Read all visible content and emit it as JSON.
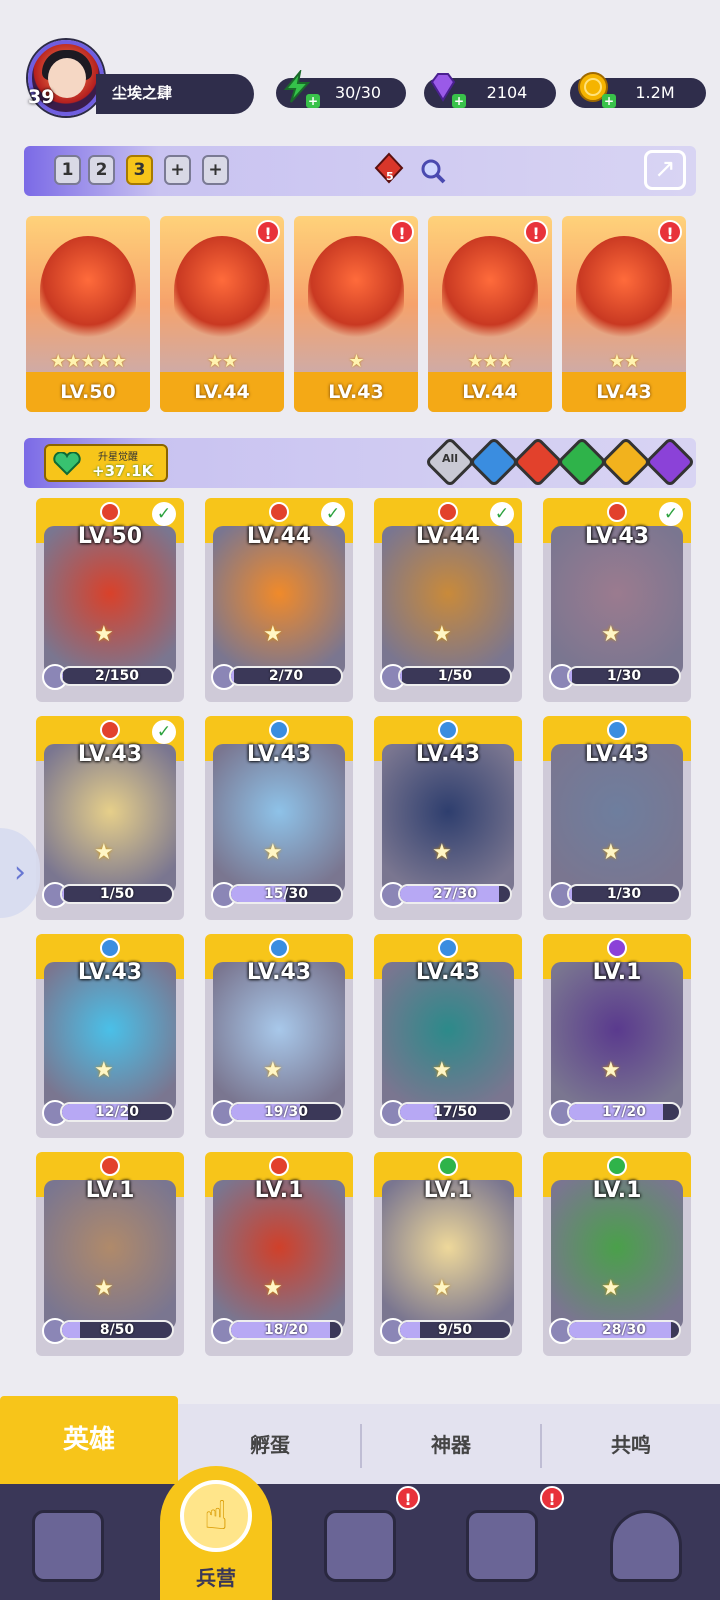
{
  "player": {
    "level": "39",
    "name": "尘埃之肆"
  },
  "resources": [
    {
      "icon": "lightning-energy-icon",
      "value": "30/30",
      "color": "#35c24a"
    },
    {
      "icon": "gem-icon",
      "value": "2104",
      "color": "#8a4ae0"
    },
    {
      "icon": "gold-coin-icon",
      "value": "1.2M",
      "color": "#f5b400"
    }
  ],
  "team_bar": {
    "slots": [
      "1",
      "2",
      "3",
      "+",
      "+"
    ],
    "selected_slot": "3",
    "fire_badge_count": "5"
  },
  "team": [
    {
      "level": "LV.50",
      "stars": "★★★★★",
      "alert": false
    },
    {
      "level": "LV.44",
      "stars": "★★",
      "alert": true
    },
    {
      "level": "LV.43",
      "stars": "★",
      "alert": true
    },
    {
      "level": "LV.44",
      "stars": "★★★",
      "alert": true
    },
    {
      "level": "LV.43",
      "stars": "★★",
      "alert": true
    }
  ],
  "awaken": {
    "label": "升星觉醒",
    "value": "+37.1K"
  },
  "filters": [
    {
      "name": "All",
      "color": "#c9c9d4"
    },
    {
      "name": "water",
      "color": "#3a8de0"
    },
    {
      "name": "fire",
      "color": "#e2412c"
    },
    {
      "name": "nature",
      "color": "#2fb34a"
    },
    {
      "name": "light",
      "color": "#f2b21d"
    },
    {
      "name": "dark",
      "color": "#8b42d8"
    }
  ],
  "heroes": [
    {
      "level": "LV.50",
      "element": "fire",
      "progress": "2/150",
      "ratio": 0.013,
      "checked": true,
      "art": "#d9412a"
    },
    {
      "level": "LV.44",
      "element": "fire",
      "progress": "2/70",
      "ratio": 0.03,
      "checked": true,
      "art": "#f08a2a"
    },
    {
      "level": "LV.44",
      "element": "fire",
      "progress": "1/50",
      "ratio": 0.02,
      "checked": true,
      "art": "#c98a3a"
    },
    {
      "level": "LV.43",
      "element": "fire",
      "progress": "1/30",
      "ratio": 0.03,
      "checked": true,
      "art": "#9b7b8f"
    },
    {
      "level": "LV.43",
      "element": "fire",
      "progress": "1/50",
      "ratio": 0.02,
      "checked": true,
      "art": "#e6cf8a"
    },
    {
      "level": "LV.43",
      "element": "water",
      "progress": "15/30",
      "ratio": 0.5,
      "checked": false,
      "art": "#8ec2e8"
    },
    {
      "level": "LV.43",
      "element": "water",
      "progress": "27/30",
      "ratio": 0.9,
      "checked": false,
      "art": "#2e3e6e"
    },
    {
      "level": "LV.43",
      "element": "water",
      "progress": "1/30",
      "ratio": 0.03,
      "checked": false,
      "art": "#6e7e9e"
    },
    {
      "level": "LV.43",
      "element": "water",
      "progress": "12/20",
      "ratio": 0.6,
      "checked": false,
      "art": "#4ac0e8"
    },
    {
      "level": "LV.43",
      "element": "water",
      "progress": "19/30",
      "ratio": 0.63,
      "checked": false,
      "art": "#a8c8ea"
    },
    {
      "level": "LV.43",
      "element": "water",
      "progress": "17/50",
      "ratio": 0.34,
      "checked": false,
      "art": "#2c8a8a"
    },
    {
      "level": "LV.1",
      "element": "dark",
      "progress": "17/20",
      "ratio": 0.85,
      "checked": false,
      "art": "#5a3a8e"
    },
    {
      "level": "LV.1",
      "element": "fire",
      "progress": "8/50",
      "ratio": 0.16,
      "checked": false,
      "art": "#b08a6a"
    },
    {
      "level": "LV.1",
      "element": "fire",
      "progress": "18/20",
      "ratio": 0.9,
      "checked": false,
      "art": "#d0402a"
    },
    {
      "level": "LV.1",
      "element": "nature",
      "progress": "9/50",
      "ratio": 0.18,
      "checked": false,
      "art": "#eed89a"
    },
    {
      "level": "LV.1",
      "element": "nature",
      "progress": "28/30",
      "ratio": 0.93,
      "checked": false,
      "art": "#4aa04a"
    }
  ],
  "sub_tabs": [
    "英雄",
    "孵蛋",
    "神器",
    "共鸣"
  ],
  "nav": {
    "items": [
      "cards-icon",
      "barracks-icon",
      "map-book-icon",
      "temple-icon",
      "mushroom-house-icon"
    ],
    "selected_label": "兵营"
  }
}
